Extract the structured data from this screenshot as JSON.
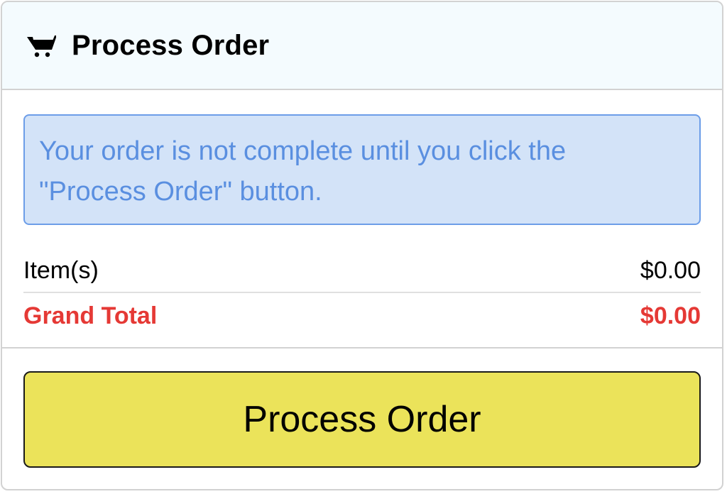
{
  "header": {
    "icon": "shopping-cart-icon",
    "title": "Process Order",
    "background": "#f4fbfe"
  },
  "alert": {
    "message_line1": "Your order is not complete until you click the",
    "message_line2": "\"Process Order\" button.",
    "text_color": "#5a8fe0",
    "background": "#d3e3f8"
  },
  "summary": {
    "items_label": "Item(s)",
    "items_value": "$0.00",
    "grand_total_label": "Grand Total",
    "grand_total_value": "$0.00",
    "total_color": "#e53935"
  },
  "footer": {
    "process_button_label": "Process Order",
    "button_color": "#ebe35a"
  }
}
